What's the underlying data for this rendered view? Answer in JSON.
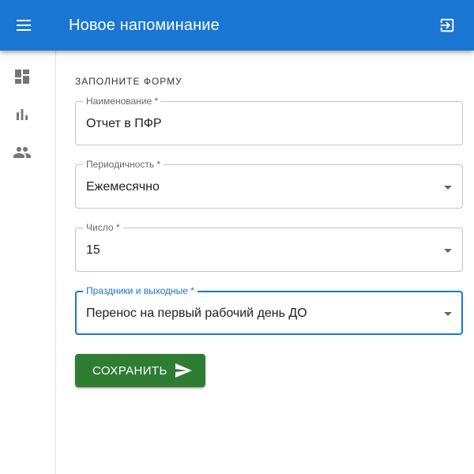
{
  "appbar": {
    "title": "Новое напоминание",
    "menu_icon": "hamburger-menu-icon",
    "logout_icon": "logout-icon",
    "color": "#1976d2"
  },
  "drawer": {
    "items": [
      {
        "icon": "dashboard-icon"
      },
      {
        "icon": "bar-chart-icon"
      },
      {
        "icon": "people-icon"
      }
    ]
  },
  "form": {
    "section_title": "ЗАПОЛНИТЕ ФОРМУ",
    "fields": [
      {
        "label": "Наименование *",
        "value": "Отчет в ПФР",
        "type": "text"
      },
      {
        "label": "Периодичность *",
        "value": "Ежемесячно",
        "type": "select"
      },
      {
        "label": "Число *",
        "value": "15",
        "type": "select"
      },
      {
        "label": "Праздники и выходные *",
        "value": "Перенос на первый рабочий день ДО",
        "type": "select",
        "focused": true
      }
    ],
    "save_button": {
      "label": "СОХРАНИТЬ",
      "icon": "send-icon",
      "color": "#2e7d32"
    }
  }
}
